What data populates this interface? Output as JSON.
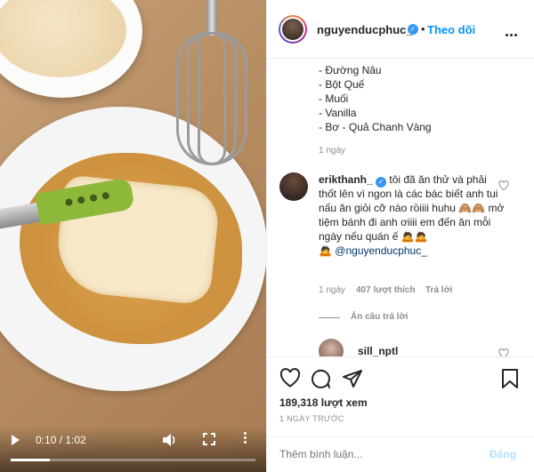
{
  "video": {
    "time_display": "0:10 / 1:02",
    "progress_fraction": 0.16
  },
  "header": {
    "username": "nguyenducphuc_",
    "separator": "•",
    "follow_label": "Theo dõi"
  },
  "caption": {
    "lines": [
      "- Đường Nâu",
      "- Bột Quế",
      "- Muối",
      "- Vanilla",
      "- Bơ - Quả Chanh Vàng"
    ],
    "time": "1 ngày"
  },
  "comment": {
    "username": "erikthanh_",
    "text": "tôi đã ăn thử và phải thốt lên vì ngon là các bác biết anh tui nấu ăn giỏi cỡ nào rồiiii huhu 🙈🙈 mở tiệm bánh đi anh ơiiii em đến ăn mỗi ngày nếu quán ế 🙇🙇",
    "mention": "@nguyenducphuc_",
    "mention_emoji": "🙇",
    "time": "1 ngày",
    "likes": "407 lượt thích",
    "reply_label": "Trả lời",
    "hide_replies": "Ẩn câu trả lời"
  },
  "reply": {
    "username": "sill_nptl"
  },
  "stats": {
    "views": "189,318 lượt xem",
    "time_ago": "1 NGÀY TRƯỚC"
  },
  "compose": {
    "placeholder": "Thêm bình luận...",
    "post_label": "Đăng"
  },
  "colors": {
    "link_blue": "#0095f6",
    "verified_blue": "#3897f0",
    "muted": "#8e8e8e"
  }
}
